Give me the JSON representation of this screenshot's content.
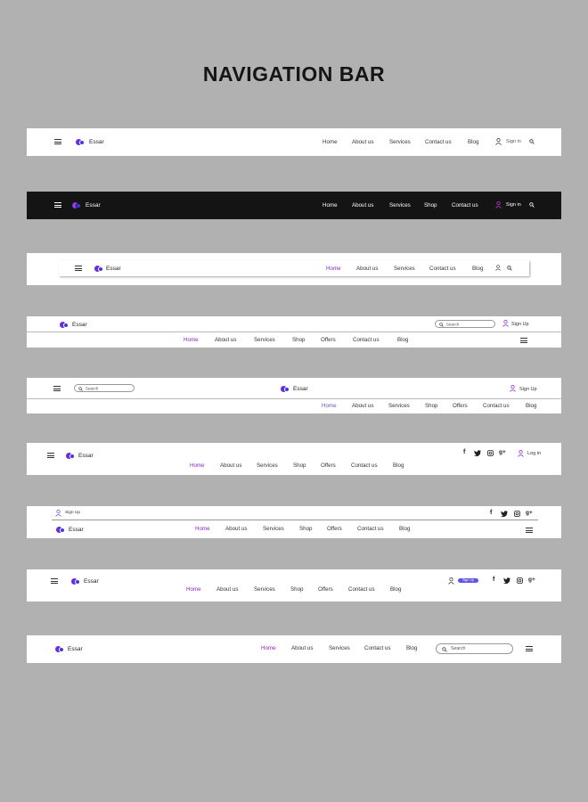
{
  "page_title": "NAVIGATION BAR",
  "brand": "Essar",
  "colors": {
    "accent": "#8e1fd6",
    "accent_blue": "#5b52e0",
    "logo": "#6a2ce0",
    "dark_bar": "#141414"
  },
  "bar1": {
    "links": [
      "Home",
      "About us",
      "Services",
      "Contact us",
      "Blog"
    ],
    "signin": "Sign in"
  },
  "bar2": {
    "links": [
      "Home",
      "About us",
      "Services",
      "Shop",
      "Contact us"
    ],
    "signin": "Sign in"
  },
  "bar3": {
    "links": [
      "Home",
      "About us",
      "Services",
      "Contact us",
      "Blog"
    ]
  },
  "bar4": {
    "search_placeholder": "Search",
    "signup": "Sign Up",
    "links": [
      "Home",
      "About us",
      "Services",
      "Shop",
      "Offers",
      "Contact us",
      "Blog"
    ]
  },
  "bar5": {
    "search_placeholder": "Search",
    "signup": "Sign Up",
    "links": [
      "Home",
      "About us",
      "Services",
      "Shop",
      "Offers",
      "Contact us",
      "Blog"
    ]
  },
  "bar6": {
    "login": "Log in",
    "links": [
      "Home",
      "About us",
      "Services",
      "Shop",
      "Offers",
      "Contact us",
      "Blog"
    ]
  },
  "bar7": {
    "signup": "Sign Up",
    "links": [
      "Home",
      "About us",
      "Services",
      "Shop",
      "Offers",
      "Contact us",
      "Blog"
    ]
  },
  "bar8": {
    "signup_button": "Sign Up",
    "links": [
      "Home",
      "About us",
      "Services",
      "Shop",
      "Offers",
      "Contact us",
      "Blog"
    ]
  },
  "bar9": {
    "search_placeholder": "Search",
    "links": [
      "Home",
      "About us",
      "Services",
      "Contact us",
      "Blog"
    ]
  }
}
